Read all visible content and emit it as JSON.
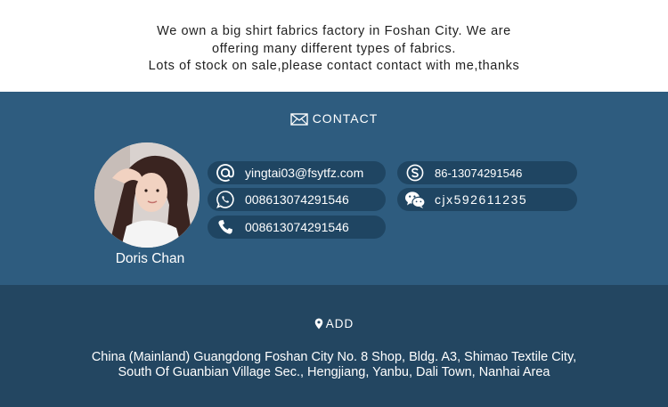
{
  "intro": {
    "line1": "We own a big shirt fabrics factory in Foshan City. We are",
    "line2": "offering many different types of fabrics.",
    "line3": "Lots of stock on sale,please contact contact with me,thanks"
  },
  "contact": {
    "heading": "CONTACT",
    "heading_icon": "envelope-icon",
    "person_name": "Doris Chan",
    "items": [
      {
        "icon": "email-at-icon",
        "value": "yingtai03@fsytfz.com"
      },
      {
        "icon": "whatsapp-icon",
        "value": "008613074291546"
      },
      {
        "icon": "phone-icon",
        "value": "008613074291546"
      },
      {
        "icon": "skype-icon",
        "value": "86-13074291546"
      },
      {
        "icon": "wechat-icon",
        "value": "cjx592611235"
      }
    ]
  },
  "address": {
    "heading": "ADD",
    "heading_icon": "map-pin-icon",
    "line1": "China (Mainland) Guangdong Foshan City No. 8 Shop, Bldg. A3, Shimao Textile City,",
    "line2": "South Of Guanbian Village Sec., Hengjiang, Yanbu, Dali Town, Nanhai Area"
  },
  "colors": {
    "contact_bg": "#2e5c7f",
    "pill_bg": "#1f4562",
    "address_bg": "#234661",
    "text_light": "#ffffff"
  }
}
